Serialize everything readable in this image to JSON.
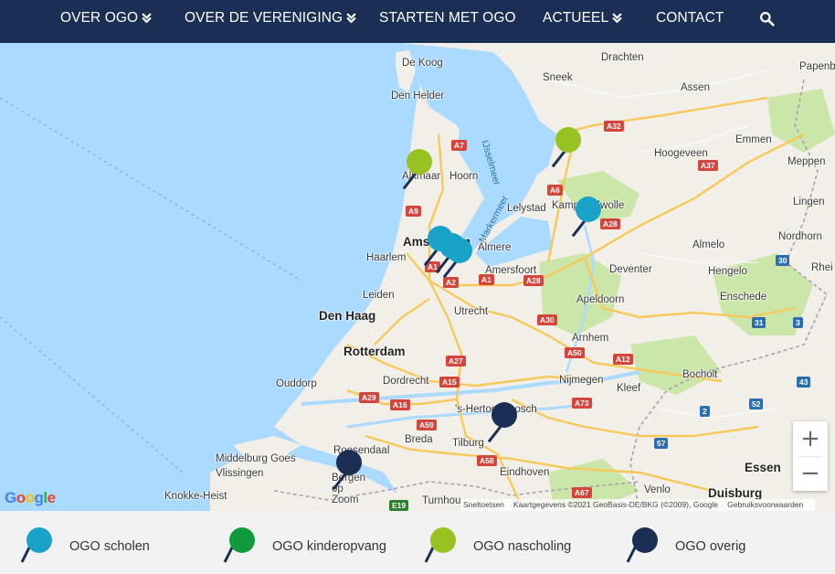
{
  "nav": {
    "items": [
      {
        "label": "OVER OGO",
        "dropdown": true
      },
      {
        "label": "OVER DE VERENIGING",
        "dropdown": true
      },
      {
        "label": "STARTEN MET OGO",
        "dropdown": false
      },
      {
        "label": "ACTUEEL",
        "dropdown": true
      },
      {
        "label": "CONTACT",
        "dropdown": false
      }
    ],
    "search_icon": "search-icon",
    "colors": {
      "bg": "#1b2f54",
      "text": "#ffffff"
    }
  },
  "map": {
    "places": {
      "de_koog": "De Koog",
      "den_helder": "Den Helder",
      "sneek": "Sneek",
      "drachten": "Drachten",
      "papenburg": "Papenb",
      "assen": "Assen",
      "emmen": "Emmen",
      "meppen": "Meppen",
      "hoogeveen": "Hoogeveen",
      "alkmaar": "Alkmaar",
      "hoorn": "Hoorn",
      "lelystad": "Lelystad",
      "kampen_zwolle": "Kampen Zwolle",
      "lingen": "Lingen",
      "amsterdam": "Amsterdam",
      "haarlem": "Haarlem",
      "almere": "Almere",
      "almelo": "Almelo",
      "nordhorn": "Nordhorn",
      "rheine": "Rhei",
      "leiden": "Leiden",
      "amersfoort": "Amersfoort",
      "deventer": "Deventer",
      "hengelo": "Hengelo",
      "enschede": "Enschede",
      "den_haag": "Den Haag",
      "utrecht": "Utrecht",
      "apeldoorn": "Apeldoorn",
      "rotterdam": "Rotterdam",
      "arnhem": "Arnhem",
      "ouddorp": "Ouddorp",
      "dordrecht": "Dordrecht",
      "nijmegen": "Nijmegen",
      "bocholt": "Bocholt",
      "kleef": "Kleef",
      "den_bosch": "'s-Hertogenbosch",
      "breda": "Breda",
      "tilburg": "Tilburg",
      "middelburg_goes": "Middelburg Goes",
      "roosendaal": "Roosendaal",
      "vlissingen": "Vlissingen",
      "bergen_op_zoom": "Bergen op Zoom",
      "eindhoven": "Eindhoven",
      "essen": "Essen",
      "knokke": "Knokke-Heist",
      "turnhout": "Turnhou",
      "venlo": "Venlo",
      "duisburg": "Duisburg",
      "ijsselmeer": "IJsselmeer",
      "markermeer": "Markermeer"
    },
    "roads": {
      "a7": "A7",
      "a9": "A9",
      "a6": "A6",
      "a32": "A32",
      "a37": "A37",
      "a28a": "A28",
      "a28b": "A28",
      "a1a": "A1",
      "a1b": "A1",
      "a2": "A2",
      "a30": "A30",
      "a27": "A27",
      "a50": "A50",
      "a12": "A12",
      "a15": "A15",
      "a29": "A29",
      "a16": "A16",
      "a59": "A59",
      "a58": "A58",
      "a73": "A73",
      "a67": "A67",
      "e19": "E19",
      "r30": "30",
      "r31": "31",
      "r43": "43",
      "r52": "52",
      "r57": "57",
      "r2": "2",
      "r3": "3"
    },
    "zoom": {
      "in": "+",
      "out": "−"
    },
    "google_logo": "Google",
    "attribution": {
      "shortcuts": "Sneltoetsen",
      "data": "Kaartgegevens ©2021 GeoBasis-DE/BKG (©2009), Google",
      "terms": "Gebruiksvoorwaarden"
    },
    "colors": {
      "water": "#aadaff",
      "land": "#f1efe7",
      "green": "#cbe6a9"
    }
  },
  "legend": {
    "items": [
      {
        "label": "OGO scholen",
        "color": "#1aa3c8"
      },
      {
        "label": "OGO kinderopvang",
        "color": "#0f9b3c"
      },
      {
        "label": "OGO nascholing",
        "color": "#98c21f"
      },
      {
        "label": "OGO overig",
        "color": "#1b2f54"
      }
    ]
  },
  "pin_colors": {
    "scholen": "#1aa3c8",
    "nascholing": "#98c21f",
    "overig": "#1b2f54"
  }
}
